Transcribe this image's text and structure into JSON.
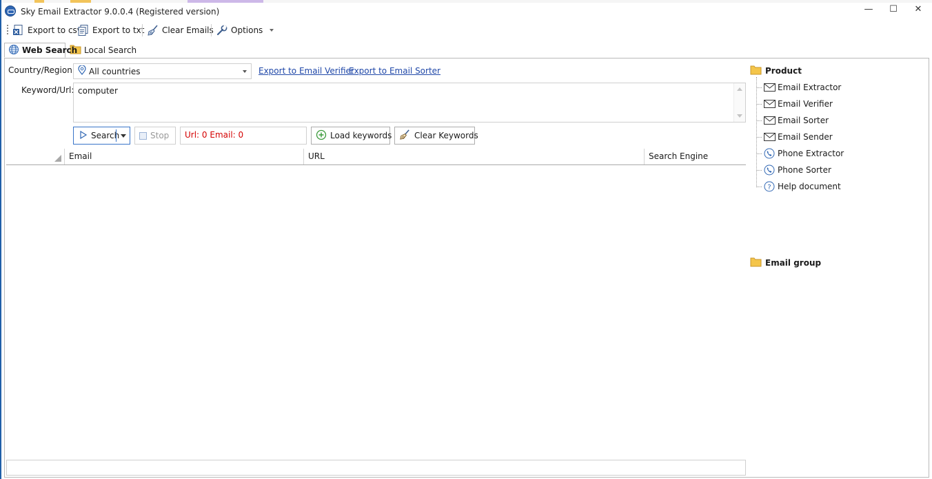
{
  "window": {
    "title": "Sky Email Extractor 9.0.0.4 (Registered version)",
    "controls": {
      "minimize": "—",
      "maximize": "☐",
      "close": "✕"
    }
  },
  "toolbar": {
    "export_csv": "Export to csv",
    "export_txt": "Export to txt",
    "clear_emails": "Clear Emails",
    "options": "Options"
  },
  "tabs": [
    {
      "label": "Web Search",
      "active": true
    },
    {
      "label": "Local Search",
      "active": false
    }
  ],
  "form": {
    "country_label": "Country/Region:",
    "country_value": "All countries",
    "export_verifier_link": "Export to Email Verifier",
    "export_sorter_link": "Export to Email Sorter",
    "keyword_label": "Keyword/Url:",
    "keyword_value": "computer"
  },
  "actions": {
    "search": "Search",
    "stop": "Stop",
    "status": "Url: 0 Email: 0",
    "load_keywords": "Load keywords",
    "clear_keywords": "Clear Keywords"
  },
  "grid": {
    "columns": [
      "Email",
      "URL",
      "Search Engine"
    ],
    "rows": []
  },
  "tree": {
    "product_label": "Product",
    "products": [
      {
        "label": "Email Extractor",
        "icon": "envelope-icon"
      },
      {
        "label": "Email Verifier",
        "icon": "envelope-icon"
      },
      {
        "label": "Email Sorter",
        "icon": "envelope-icon"
      },
      {
        "label": "Email Sender",
        "icon": "envelope-icon"
      },
      {
        "label": "Phone Extractor",
        "icon": "phone-icon"
      },
      {
        "label": "Phone Sorter",
        "icon": "phone-icon"
      },
      {
        "label": "Help document",
        "icon": "help-icon"
      }
    ],
    "email_group_label": "Email group"
  },
  "colors": {
    "accent_blue": "#3874c8",
    "link_blue": "#1f47a8",
    "status_red": "#d40000",
    "folder_yellow": "#f4c54a"
  }
}
